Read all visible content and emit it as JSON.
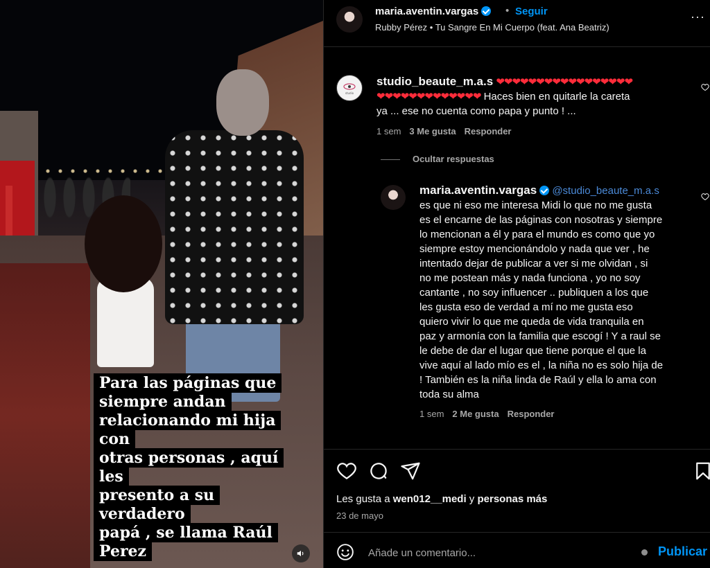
{
  "post": {
    "author": "maria.aventin.vargas",
    "follow_label": "Seguir",
    "separator": "•",
    "music": "Rubby Pérez • Tu Sangre En Mi Cuerpo (feat. Ana Beatriz)",
    "more_label": "···",
    "media_caption_lines": [
      "Para las páginas que",
      "siempre andan",
      "relacionando mi hija con",
      "otras personas , aquí les",
      "presento a su verdadero",
      "papá , se llama Raúl",
      "Perez"
    ]
  },
  "comments": [
    {
      "user": "studio_beaute_m.a.s",
      "hearts_line1": "❤❤❤❤❤❤❤❤❤❤❤❤❤❤❤❤❤",
      "hearts_line2": "❤❤❤❤❤❤❤❤❤❤❤❤❤",
      "text_after_hearts": "Haces bien en quitarle la careta",
      "text_line3": "ya ... ese no cuenta como papa y punto ! ...",
      "time": "1 sem",
      "likes": "3 Me gusta",
      "reply_label": "Responder"
    }
  ],
  "hide_replies_label": "Ocultar respuestas",
  "reply": {
    "user": "maria.aventin.vargas",
    "mention": "@studio_beaute_m.a.s",
    "lines": [
      "es que ni eso me interesa Midi lo que no me gusta",
      "es el encarne de las páginas con nosotras y siempre",
      "lo mencionan a él y para el mundo es como que yo",
      "siempre estoy mencionándolo y nada que ver , he",
      "intentado dejar de publicar a ver si me olvidan , si",
      "no me postean más y nada funciona , yo no soy",
      "cantante , no soy influencer .. publiquen a los que",
      "les gusta eso de verdad a mí no me gusta eso",
      "quiero vivir lo que me queda de vida tranquila en",
      "paz y armonía con la familia que escogí ! Y a raul se",
      "le debe de dar el lugar que tiene porque el que la",
      "vive aquí al lado mío es el , la niña no es solo hija de",
      "! También es la niña linda de Raúl y ella lo ama con",
      "toda su alma"
    ],
    "time": "1 sem",
    "likes": "2 Me gusta",
    "reply_label": "Responder"
  },
  "likes_line": {
    "prefix": "Les gusta a ",
    "user": "wen012__medi",
    "middle": " y ",
    "suffix": "personas más"
  },
  "date": "23 de mayo",
  "compose": {
    "placeholder": "Añade un comentario...",
    "publish_label": "Publicar"
  },
  "colors": {
    "accent": "#0095f6",
    "background": "#000000",
    "muted_text": "#a8a8a8",
    "heart": "#ff2c3a"
  }
}
